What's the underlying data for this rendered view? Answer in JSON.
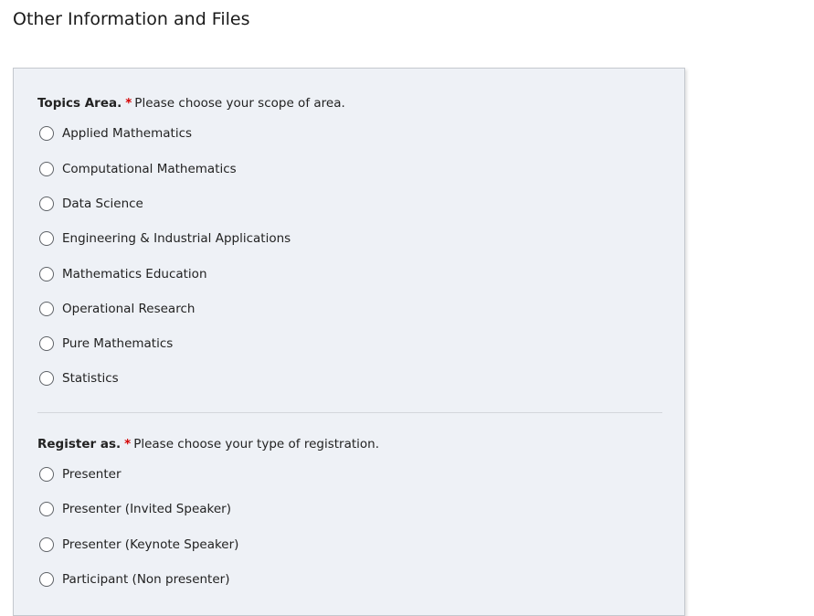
{
  "page_title": "Other Information and Files",
  "topics": {
    "label": "Topics Area.",
    "required_mark": "*",
    "hint": "Please choose your scope of area.",
    "options": [
      "Applied Mathematics",
      "Computational Mathematics",
      "Data Science",
      "Engineering & Industrial Applications",
      "Mathematics Education",
      "Operational Research",
      "Pure Mathematics",
      "Statistics"
    ]
  },
  "register": {
    "label": "Register as.",
    "required_mark": "*",
    "hint": "Please choose your type of registration.",
    "options": [
      "Presenter",
      "Presenter (Invited Speaker)",
      "Presenter (Keynote Speaker)",
      "Participant (Non presenter)"
    ]
  }
}
